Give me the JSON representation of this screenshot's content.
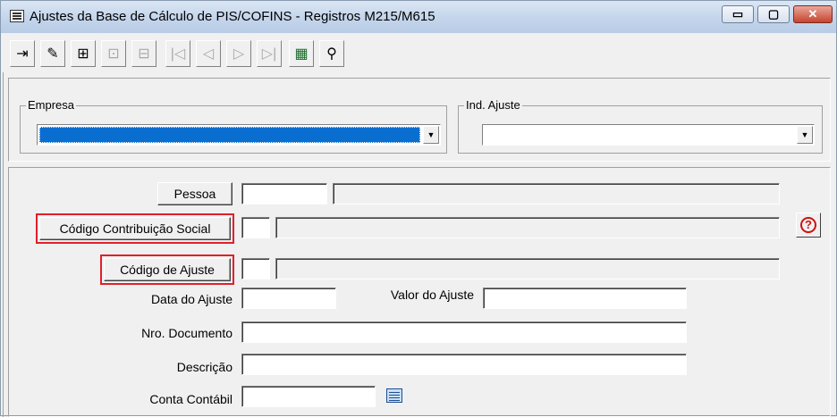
{
  "window": {
    "title": "Ajustes da Base de Cálculo de PIS/COFINS - Registros M215/M615",
    "controls": {
      "minimize": "▭",
      "maximize": "▢",
      "close": "✕"
    }
  },
  "toolbar": {
    "tools": [
      {
        "icon": "exit-door-icon",
        "glyph": "⇥",
        "enabled": true
      },
      {
        "icon": "eraser-icon",
        "glyph": "✎",
        "enabled": true
      },
      {
        "icon": "new-record-icon",
        "glyph": "⊞",
        "enabled": true
      },
      {
        "icon": "edit-record-icon",
        "glyph": "⊡",
        "enabled": false
      },
      {
        "icon": "delete-record-icon",
        "glyph": "⊟",
        "enabled": false
      },
      {
        "icon": "first-record-icon",
        "glyph": "|◁",
        "enabled": false
      },
      {
        "icon": "previous-record-icon",
        "glyph": "◁",
        "enabled": false
      },
      {
        "icon": "next-record-icon",
        "glyph": "▷",
        "enabled": false
      },
      {
        "icon": "last-record-icon",
        "glyph": "▷|",
        "enabled": false
      },
      {
        "icon": "spreadsheet-icon",
        "glyph": "▦",
        "enabled": true
      },
      {
        "icon": "binoculars-search-icon",
        "glyph": "⚲",
        "enabled": true
      }
    ]
  },
  "header": {
    "empresa_label": "Empresa",
    "ind_ajuste_label": "Ind. Ajuste",
    "empresa_value": "",
    "ind_ajuste_value": ""
  },
  "form": {
    "pessoa_button": "Pessoa",
    "codigo_contribuicao_button": "Código Contribuição Social",
    "codigo_ajuste_button": "Código de Ajuste",
    "data_ajuste_label": "Data do Ajuste",
    "valor_ajuste_label": "Valor do Ajuste",
    "nro_documento_label": "Nro. Documento",
    "descricao_label": "Descrição",
    "conta_contabil_label": "Conta Contábil",
    "help_glyph": "?"
  },
  "colors": {
    "highlight_box": "#e0202a",
    "selection": "#0a6ed1"
  }
}
